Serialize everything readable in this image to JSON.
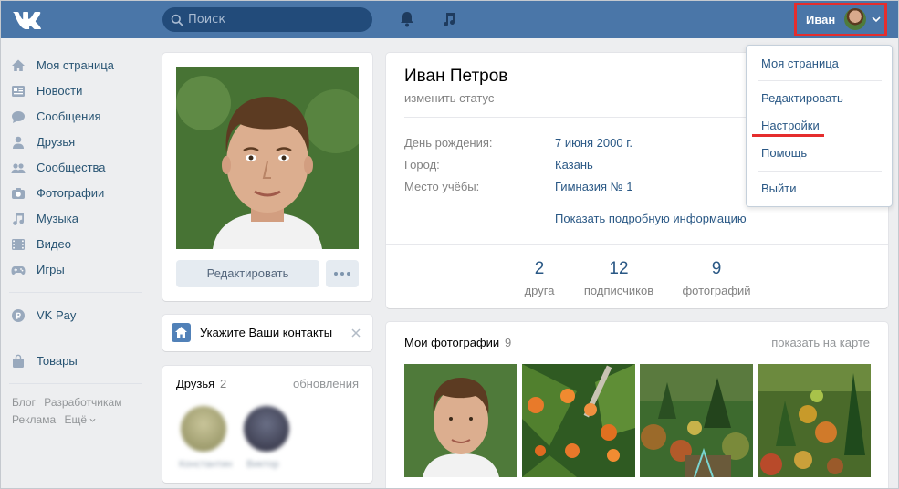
{
  "header": {
    "search_placeholder": "Поиск",
    "user_name": "Иван",
    "brand_color": "#4a76a8",
    "highlight_color": "#e52d2d"
  },
  "left_menu": {
    "items": [
      {
        "label": "Моя страница",
        "icon": "home-icon"
      },
      {
        "label": "Новости",
        "icon": "news-icon"
      },
      {
        "label": "Сообщения",
        "icon": "messages-icon"
      },
      {
        "label": "Друзья",
        "icon": "friends-icon"
      },
      {
        "label": "Сообщества",
        "icon": "groups-icon"
      },
      {
        "label": "Фотографии",
        "icon": "camera-icon"
      },
      {
        "label": "Музыка",
        "icon": "music-icon"
      },
      {
        "label": "Видео",
        "icon": "video-icon"
      },
      {
        "label": "Игры",
        "icon": "gamepad-icon"
      }
    ],
    "vkpay": "VK Pay",
    "goods": "Товары",
    "footer": {
      "blog": "Блог",
      "dev": "Разработчикам",
      "ads": "Реклама",
      "more": "Ещё"
    }
  },
  "avatar_card": {
    "edit_button": "Редактировать"
  },
  "contacts_card": {
    "label": "Укажите Ваши контакты"
  },
  "friends_card": {
    "title": "Друзья",
    "count": "2",
    "updates": "обновления",
    "names": [
      "Константин",
      "Виктор"
    ]
  },
  "profile": {
    "name": "Иван Петров",
    "status": "изменить статус",
    "info": [
      {
        "label": "День рождения:",
        "value": "7 июня 2000 г."
      },
      {
        "label": "Город:",
        "value": "Казань"
      },
      {
        "label": "Место учёбы:",
        "value": "Гимназия № 1"
      }
    ],
    "more_info": "Показать подробную информацию",
    "stats": [
      {
        "num": "2",
        "label": "друга"
      },
      {
        "num": "12",
        "label": "подписчиков"
      },
      {
        "num": "9",
        "label": "фотографий"
      }
    ]
  },
  "photos_card": {
    "title": "Мои фотографии",
    "count": "9",
    "map_link": "показать на карте"
  },
  "dropdown": {
    "items": [
      "Моя страница",
      "Редактировать",
      "Настройки",
      "Помощь",
      "Выйти"
    ]
  }
}
